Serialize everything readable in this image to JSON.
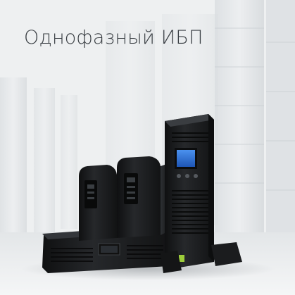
{
  "tile": {
    "title": "Однофазный ИБП"
  },
  "icons": {
    "background": "server-room-background",
    "product": "ups-product-group-image"
  },
  "colors": {
    "background": "#eef0f1",
    "title": "#3a3f44",
    "product_body": "#1c1e20",
    "display": "#2a6fd6",
    "status_led": "#9ccc3a"
  }
}
